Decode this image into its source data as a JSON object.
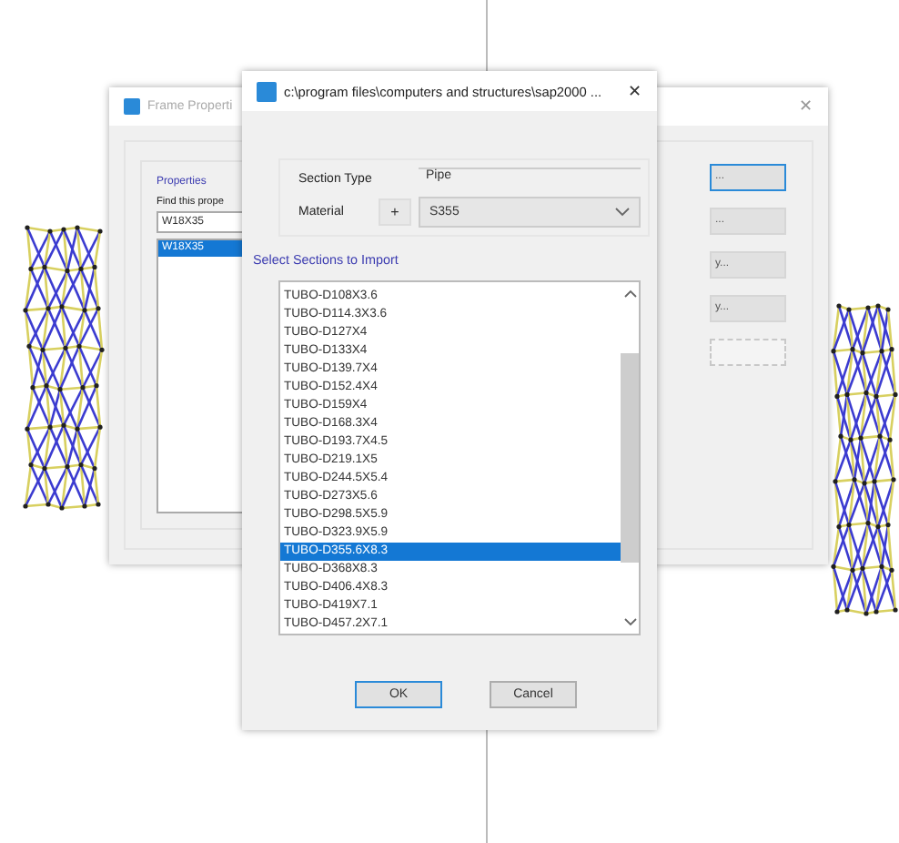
{
  "back_window": {
    "title": "Frame Properti",
    "close": "✕",
    "group_label": "Properties",
    "find_label": "Find this prope",
    "find_value": "W18X35",
    "list": [
      {
        "label": "W18X35",
        "selected": true
      }
    ],
    "buttons": [
      {
        "label": "...",
        "focused": true,
        "disabled": false
      },
      {
        "label": "...",
        "focused": false,
        "disabled": false
      },
      {
        "label": "y...",
        "focused": false,
        "disabled": false
      },
      {
        "label": "y...",
        "focused": false,
        "disabled": false
      },
      {
        "focused": false,
        "disabled": true
      }
    ]
  },
  "dialog": {
    "title": "c:\\program files\\computers and structures\\sap2000 ...",
    "close": "✕",
    "section_type_label": "Section Type",
    "section_type": "Pipe",
    "material_label": "Material",
    "add_button": "+",
    "material": "S355",
    "list_label": "Select Sections to Import",
    "sections": [
      {
        "label": "TUBO-D108X3.6",
        "selected": false
      },
      {
        "label": "TUBO-D114.3X3.6",
        "selected": false
      },
      {
        "label": "TUBO-D127X4",
        "selected": false
      },
      {
        "label": "TUBO-D133X4",
        "selected": false
      },
      {
        "label": "TUBO-D139.7X4",
        "selected": false
      },
      {
        "label": "TUBO-D152.4X4",
        "selected": false
      },
      {
        "label": "TUBO-D159X4",
        "selected": false
      },
      {
        "label": "TUBO-D168.3X4",
        "selected": false
      },
      {
        "label": "TUBO-D193.7X4.5",
        "selected": false
      },
      {
        "label": "TUBO-D219.1X5",
        "selected": false
      },
      {
        "label": "TUBO-D244.5X5.4",
        "selected": false
      },
      {
        "label": "TUBO-D273X5.6",
        "selected": false
      },
      {
        "label": "TUBO-D298.5X5.9",
        "selected": false
      },
      {
        "label": "TUBO-D323.9X5.9",
        "selected": false
      },
      {
        "label": "TUBO-D355.6X8.3",
        "selected": true
      },
      {
        "label": "TUBO-D368X8.3",
        "selected": false
      },
      {
        "label": "TUBO-D406.4X8.3",
        "selected": false
      },
      {
        "label": "TUBO-D419X7.1",
        "selected": false
      },
      {
        "label": "TUBO-D457.2X7.1",
        "selected": false
      }
    ],
    "ok": "OK",
    "cancel": "Cancel"
  }
}
